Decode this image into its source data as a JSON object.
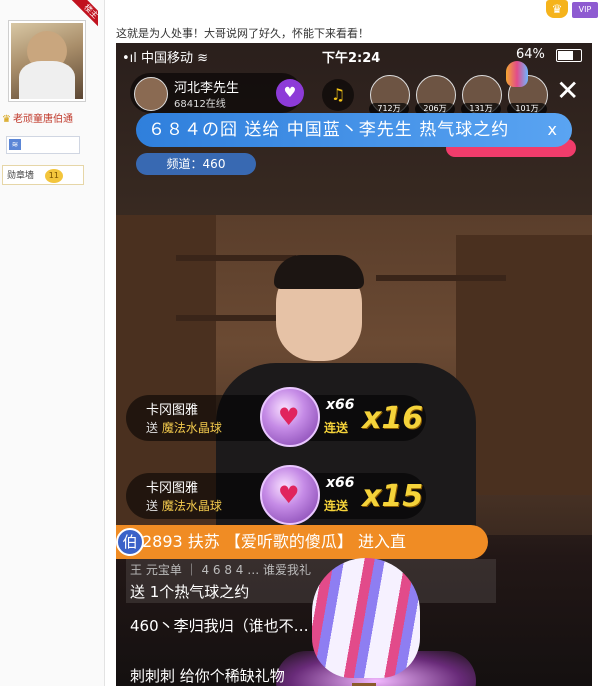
{
  "forum": {
    "badge_text": "楼主",
    "username": "老顽童唐伯通",
    "level_icon": "≋",
    "medal_label": "勋章墙",
    "medal_count": "11",
    "vip_text": "VIP",
    "post_text": "这就是为人处事！大哥说网了好久，怀能下来看看！"
  },
  "phone": {
    "status": {
      "carrier": "中国移动",
      "time": "下午2:24",
      "battery": "64%"
    },
    "host": {
      "name": "河北李先生",
      "online": "68412在线"
    },
    "viewers": [
      "712万",
      "206万",
      "131万",
      "101万"
    ],
    "gift_banner": "６８４の囧 送给 中国蓝丶李先生 热气球之约",
    "banner_close": "x",
    "channel": "频道：460",
    "combos": [
      {
        "sender": "卡冈图雅",
        "send_word": "送",
        "gift": "魔法水晶球",
        "count": "x66",
        "lianson": "连送",
        "big": "x16"
      },
      {
        "sender": "卡冈图雅",
        "send_word": "送",
        "gift": "魔法水晶球",
        "count": "x66",
        "lianson": "连送",
        "big": "x15"
      }
    ],
    "join": {
      "tag": "伯",
      "text": "2893 扶苏 【爱听歌的傻瓜】 进入直"
    },
    "chat_box": {
      "line1": "王 元宝单 ｜ 4 6 8 4 … 谁爱我礼",
      "line2": "送 1个热气球之约"
    },
    "chat2": "460丶李归我归（谁也不… 退中 气球🎈？",
    "chat3": "刺刺刺 给你个稀缺礼物"
  }
}
